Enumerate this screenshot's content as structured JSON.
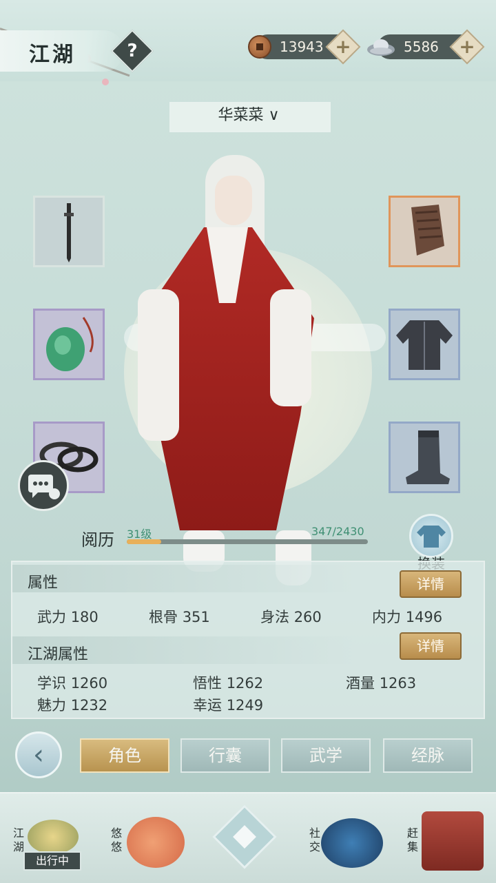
{
  "header": {
    "title": "江湖",
    "help_symbol": "?",
    "copper": "13943",
    "silver": "5586",
    "plus_symbol": "+"
  },
  "character": {
    "name": "华菜菜"
  },
  "equipment": {
    "left": [
      "weapon-dagger-icon",
      "jade-pendant-icon",
      "bracelet-icon"
    ],
    "right": [
      "bracer-icon",
      "robe-armor-icon",
      "boots-icon"
    ]
  },
  "experience": {
    "label": "阅历",
    "level": "31级",
    "value": "347/2430",
    "progress": 0.143
  },
  "outfit": {
    "label": "换装"
  },
  "attributes": {
    "section_title": "属性",
    "detail_label": "详情",
    "items": [
      {
        "name": "武力",
        "value": "180"
      },
      {
        "name": "根骨",
        "value": "351"
      },
      {
        "name": "身法",
        "value": "260"
      },
      {
        "name": "内力",
        "value": "1496"
      }
    ]
  },
  "jianghu_attributes": {
    "section_title": "江湖属性",
    "detail_label": "详情",
    "items": [
      {
        "name": "学识",
        "value": "1260"
      },
      {
        "name": "悟性",
        "value": "1262"
      },
      {
        "name": "酒量",
        "value": "1263"
      },
      {
        "name": "魅力",
        "value": "1232"
      },
      {
        "name": "幸运",
        "value": "1249"
      }
    ]
  },
  "tabs": [
    {
      "label": "角色",
      "active": true
    },
    {
      "label": "行囊",
      "active": false
    },
    {
      "label": "武学",
      "active": false
    },
    {
      "label": "经脉",
      "active": false
    }
  ],
  "bottom_nav": {
    "jianghu": "江湖",
    "travel_status": "出行中",
    "youyou": "悠悠",
    "social": "社交",
    "market": "赶集"
  },
  "colors": {
    "accent_gold": "#c49a55",
    "robe_red": "#a8241f",
    "exp_green": "#3f8f73"
  }
}
